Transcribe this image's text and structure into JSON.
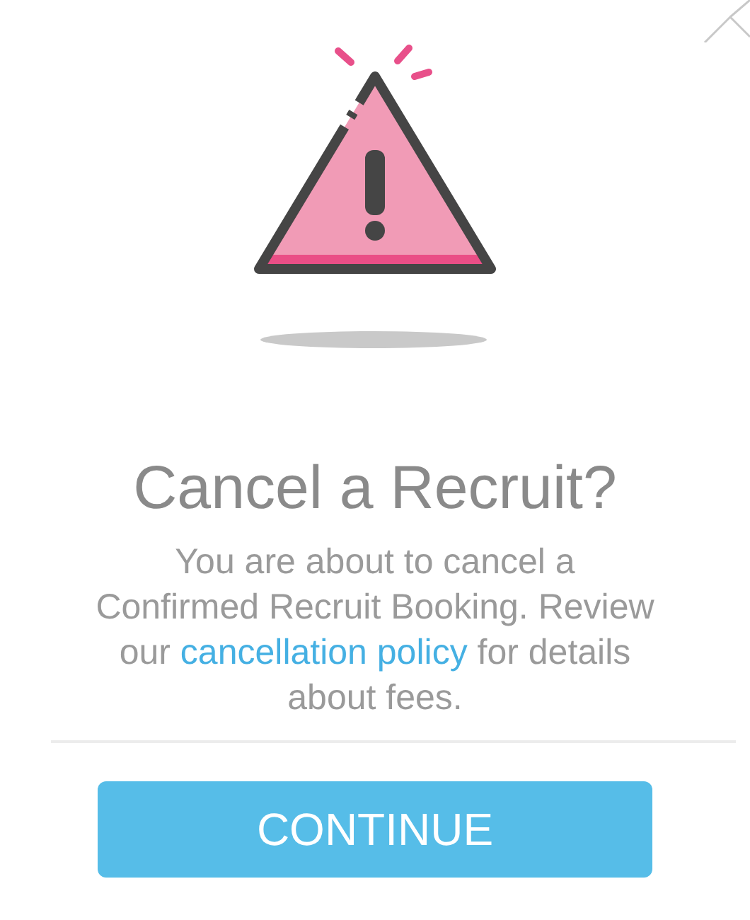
{
  "dialog": {
    "title": "Cancel a Recruit?",
    "message": {
      "before": "You are about to cancel a Confirmed Recruit Booking. Review our ",
      "link": "cancellation policy",
      "after": " for details about fees."
    },
    "button": "CONTINUE"
  }
}
